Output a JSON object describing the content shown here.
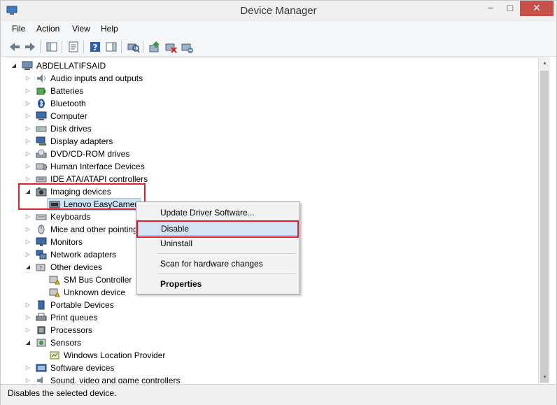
{
  "window": {
    "title": "Device Manager",
    "minimize": "−",
    "maximize": "□",
    "close": "✕"
  },
  "menu": [
    {
      "label": "File"
    },
    {
      "label": "Action"
    },
    {
      "label": "View"
    },
    {
      "label": "Help"
    }
  ],
  "toolbar_icons": [
    "back-icon",
    "forward-icon",
    "show-hide-console-tree-icon",
    "properties-icon",
    "help-icon",
    "action-pane-icon",
    "scan-hardware-icon",
    "update-driver-icon",
    "disable-device-icon",
    "uninstall-device-icon"
  ],
  "tree": {
    "root": "ABDELLATIFSAID",
    "items": [
      {
        "label": "Audio inputs and outputs",
        "icon": "audio-icon"
      },
      {
        "label": "Batteries",
        "icon": "battery-icon"
      },
      {
        "label": "Bluetooth",
        "icon": "bluetooth-icon"
      },
      {
        "label": "Computer",
        "icon": "computer-icon"
      },
      {
        "label": "Disk drives",
        "icon": "disk-drive-icon"
      },
      {
        "label": "Display adapters",
        "icon": "display-adapter-icon"
      },
      {
        "label": "DVD/CD-ROM drives",
        "icon": "dvd-drive-icon"
      },
      {
        "label": "Human Interface Devices",
        "icon": "hid-icon"
      },
      {
        "label": "IDE ATA/ATAPI controllers",
        "icon": "ide-controller-icon"
      },
      {
        "label": "Imaging devices",
        "icon": "camera-icon",
        "expanded": true,
        "children": [
          {
            "label": "Lenovo EasyCamera",
            "icon": "webcam-icon",
            "selected": true
          }
        ]
      },
      {
        "label": "Keyboards",
        "icon": "keyboard-icon"
      },
      {
        "label": "Mice and other pointing devices",
        "icon": "mouse-icon"
      },
      {
        "label": "Monitors",
        "icon": "monitor-icon"
      },
      {
        "label": "Network adapters",
        "icon": "network-adapter-icon"
      },
      {
        "label": "Other devices",
        "icon": "other-devices-icon",
        "expanded": true,
        "children": [
          {
            "label": "SM Bus Controller",
            "icon": "warning-device-icon"
          },
          {
            "label": "Unknown device",
            "icon": "warning-device-icon"
          }
        ]
      },
      {
        "label": "Portable Devices",
        "icon": "portable-device-icon"
      },
      {
        "label": "Print queues",
        "icon": "printer-icon"
      },
      {
        "label": "Processors",
        "icon": "processor-icon"
      },
      {
        "label": "Sensors",
        "icon": "sensor-icon",
        "expanded": true,
        "children": [
          {
            "label": "Windows Location Provider",
            "icon": "location-provider-icon"
          }
        ]
      },
      {
        "label": "Software devices",
        "icon": "software-device-icon"
      },
      {
        "label": "Sound, video and game controllers",
        "icon": "sound-icon"
      }
    ]
  },
  "context_menu": {
    "items": [
      {
        "label": "Update Driver Software...",
        "bold": false
      },
      {
        "label": "Disable",
        "bold": false,
        "highlighted": true
      },
      {
        "label": "Uninstall",
        "bold": false
      },
      {
        "label": "Scan for hardware changes",
        "bold": false
      },
      {
        "label": "Properties",
        "bold": true
      }
    ]
  },
  "status": {
    "text": "Disables the selected device."
  },
  "colors": {
    "highlight": "#d5e3f4",
    "annotation": "#e0202a",
    "selection": "#cce4f7"
  }
}
